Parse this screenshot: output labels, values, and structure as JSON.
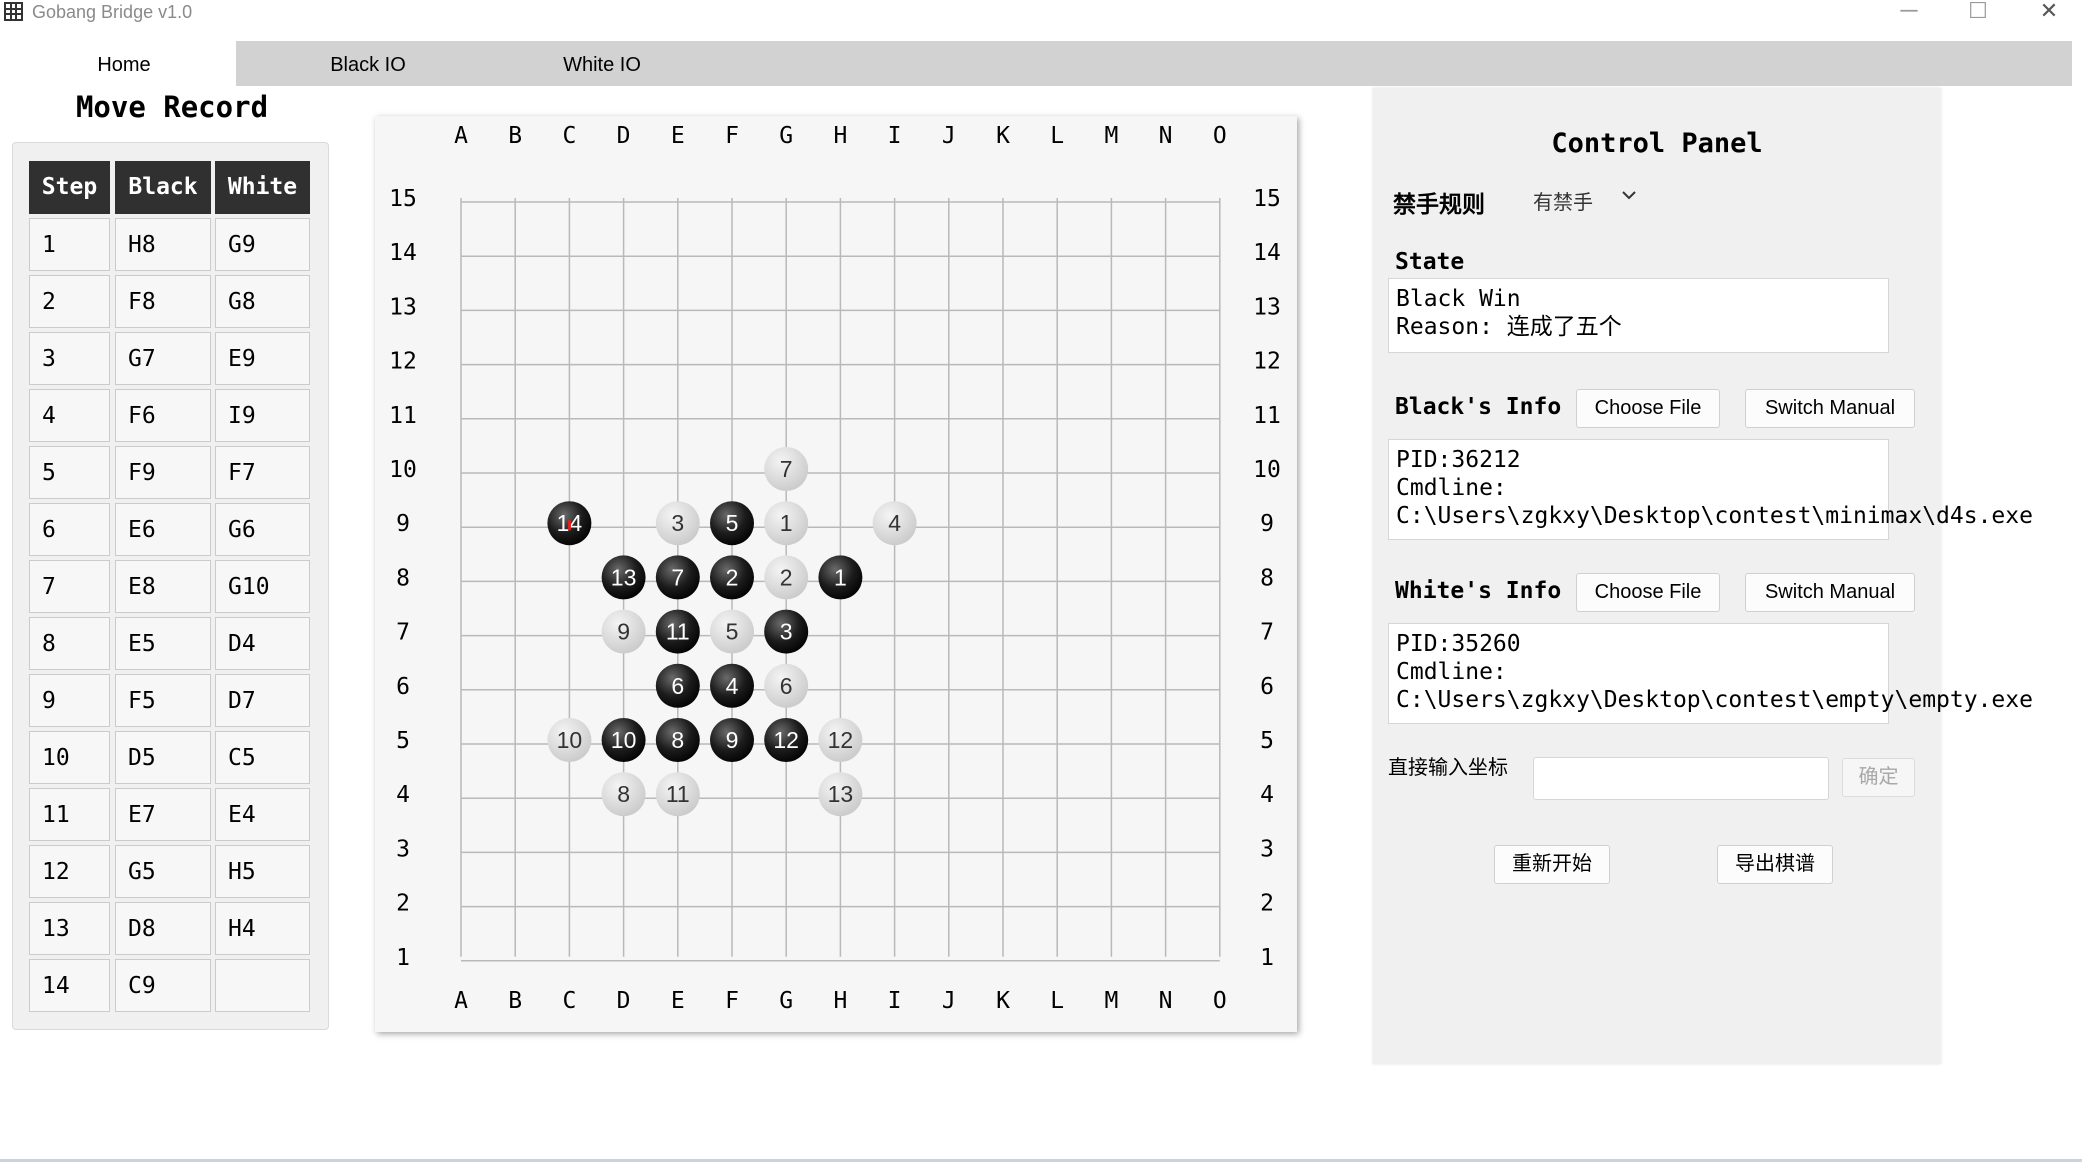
{
  "window": {
    "title": "Gobang Bridge v1.0",
    "minimize": "─",
    "maximize": "☐",
    "close": "✕"
  },
  "tabs": [
    {
      "label": "Home",
      "active": true
    },
    {
      "label": "Black IO",
      "active": false
    },
    {
      "label": "White IO",
      "active": false
    }
  ],
  "move_record": {
    "title": "Move Record",
    "headers": [
      "Step",
      "Black",
      "White"
    ],
    "rows": [
      [
        "1",
        "H8",
        "G9"
      ],
      [
        "2",
        "F8",
        "G8"
      ],
      [
        "3",
        "G7",
        "E9"
      ],
      [
        "4",
        "F6",
        "I9"
      ],
      [
        "5",
        "F9",
        "F7"
      ],
      [
        "6",
        "E6",
        "G6"
      ],
      [
        "7",
        "E8",
        "G10"
      ],
      [
        "8",
        "E5",
        "D4"
      ],
      [
        "9",
        "F5",
        "D7"
      ],
      [
        "10",
        "D5",
        "C5"
      ],
      [
        "11",
        "E7",
        "E4"
      ],
      [
        "12",
        "G5",
        "H5"
      ],
      [
        "13",
        "D8",
        "H4"
      ],
      [
        "14",
        "C9",
        ""
      ]
    ]
  },
  "board": {
    "columns": [
      "A",
      "B",
      "C",
      "D",
      "E",
      "F",
      "G",
      "H",
      "I",
      "J",
      "K",
      "L",
      "M",
      "N",
      "O"
    ],
    "rows": [
      "15",
      "14",
      "13",
      "12",
      "11",
      "10",
      "9",
      "8",
      "7",
      "6",
      "5",
      "4",
      "3",
      "2",
      "1"
    ],
    "last_move_marker_color": "#e02020",
    "stones": [
      {
        "color": "black",
        "num": "1",
        "pos": "H8"
      },
      {
        "color": "white",
        "num": "1",
        "pos": "G9"
      },
      {
        "color": "black",
        "num": "2",
        "pos": "F8"
      },
      {
        "color": "white",
        "num": "2",
        "pos": "G8"
      },
      {
        "color": "black",
        "num": "3",
        "pos": "G7"
      },
      {
        "color": "white",
        "num": "3",
        "pos": "E9"
      },
      {
        "color": "black",
        "num": "4",
        "pos": "F6"
      },
      {
        "color": "white",
        "num": "4",
        "pos": "I9"
      },
      {
        "color": "black",
        "num": "5",
        "pos": "F9"
      },
      {
        "color": "white",
        "num": "5",
        "pos": "F7"
      },
      {
        "color": "black",
        "num": "6",
        "pos": "E6"
      },
      {
        "color": "white",
        "num": "6",
        "pos": "G6"
      },
      {
        "color": "black",
        "num": "7",
        "pos": "E8"
      },
      {
        "color": "white",
        "num": "7",
        "pos": "G10"
      },
      {
        "color": "black",
        "num": "8",
        "pos": "E5"
      },
      {
        "color": "white",
        "num": "8",
        "pos": "D4"
      },
      {
        "color": "black",
        "num": "9",
        "pos": "F5"
      },
      {
        "color": "white",
        "num": "9",
        "pos": "D7"
      },
      {
        "color": "black",
        "num": "10",
        "pos": "D5"
      },
      {
        "color": "white",
        "num": "10",
        "pos": "C5"
      },
      {
        "color": "black",
        "num": "11",
        "pos": "E7"
      },
      {
        "color": "white",
        "num": "11",
        "pos": "E4"
      },
      {
        "color": "black",
        "num": "12",
        "pos": "G5"
      },
      {
        "color": "white",
        "num": "12",
        "pos": "H5"
      },
      {
        "color": "black",
        "num": "13",
        "pos": "D8"
      },
      {
        "color": "white",
        "num": "13",
        "pos": "H4"
      },
      {
        "color": "black",
        "num": "14",
        "pos": "C9",
        "last": true
      }
    ]
  },
  "control_panel": {
    "title": "Control Panel",
    "rule_label": "禁手规则",
    "rule_value": "有禁手",
    "state_label": "State",
    "state_lines": [
      "Black Win",
      "Reason: 连成了五个"
    ],
    "black_info_label": "Black's Info",
    "black_info_lines": [
      "PID:36212",
      "Cmdline:",
      "C:\\Users\\zgkxy\\Desktop\\contest\\minimax\\d4s.exe"
    ],
    "white_info_label": "White's Info",
    "white_info_lines": [
      "PID:35260",
      "Cmdline:",
      "C:\\Users\\zgkxy\\Desktop\\contest\\empty\\empty.exe"
    ],
    "choose_file_label": "Choose File",
    "switch_manual_label": "Switch Manual",
    "direct_input_label": "直接输入坐标",
    "direct_input_value": "",
    "confirm_label": "确定",
    "restart_label": "重新开始",
    "export_label": "导出棋谱"
  }
}
